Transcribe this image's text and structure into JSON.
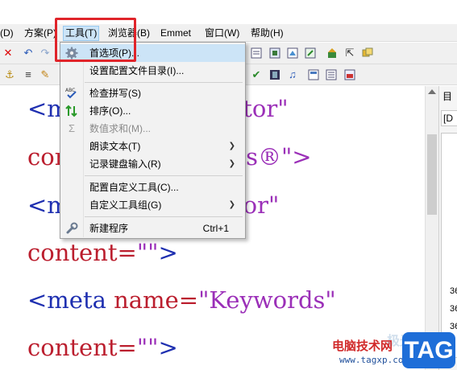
{
  "menubar": {
    "items": [
      {
        "label": "(D)"
      },
      {
        "label": "方案(P)"
      },
      {
        "label": "工具(T)"
      },
      {
        "label": "浏览器(B)"
      },
      {
        "label": "Emmet"
      },
      {
        "label": "窗口(W)"
      },
      {
        "label": "帮助(H)"
      }
    ]
  },
  "tools_menu": {
    "items": [
      {
        "label": "首选项(P)...",
        "icon": "gear-icon"
      },
      {
        "label": "设置配置文件目录(I)..."
      },
      {
        "label": "检查拼写(S)",
        "icon": "spellcheck-icon"
      },
      {
        "label": "排序(O)...",
        "icon": "sort-icon"
      },
      {
        "label": "数值求和(M)...",
        "icon": "sum-icon",
        "disabled": true
      },
      {
        "label": "朗读文本(T)",
        "submenu": true
      },
      {
        "label": "记录键盘输入(R)",
        "submenu": true
      },
      {
        "label": "配置自定义工具(C)..."
      },
      {
        "label": "自定义工具组(G)",
        "submenu": true
      },
      {
        "label": "新建程序",
        "icon": "wrench-icon",
        "shortcut": "Ctrl+1"
      }
    ]
  },
  "editor": {
    "lines": [
      {
        "tag": "<me",
        "hidden_tail": "erator",
        "close": "\""
      },
      {
        "attr": "con",
        "tail": "us®\">"
      },
      {
        "tag": "<me",
        "tail": "hor\""
      },
      {
        "attr": "content=",
        "str": "\"\"",
        "close": ">"
      },
      {
        "tag": "<meta ",
        "attr": "name=",
        "str": "\"Keywords\""
      },
      {
        "attr": "content=",
        "str": "\"\"",
        "close": ">"
      }
    ]
  },
  "right_panel": {
    "tab": "目",
    "header": "[D",
    "rows": [
      "36",
      "36",
      "36"
    ]
  },
  "watermark": {
    "site_name": "电脑技术网",
    "url": "www.tagxp.com",
    "badge": "TAG",
    "ghost": "极光下载站"
  },
  "colors": {
    "highlight": "#e0242a",
    "tag": "#1e2fb0",
    "attr": "#bb1e2e",
    "string": "#9b2fb8",
    "menu_hover": "#cce4f7",
    "badge": "#1e6ed8"
  }
}
